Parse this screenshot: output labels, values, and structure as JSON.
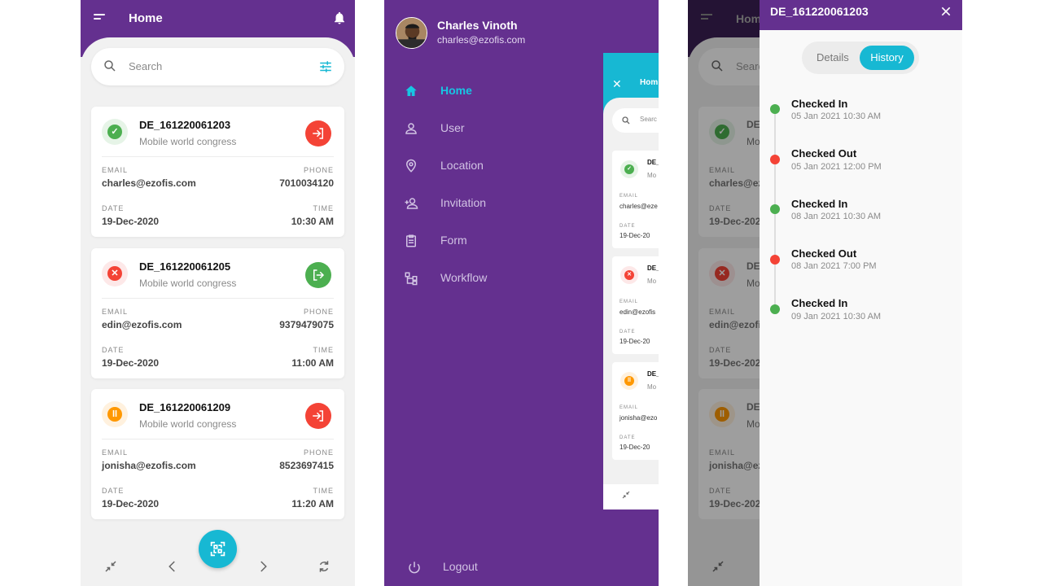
{
  "home": {
    "title": "Home",
    "search_placeholder": "Search",
    "cards": [
      {
        "id": "DE_161220061203",
        "event": "Mobile world congress",
        "email_label": "EMAIL",
        "email": "charles@ezofis.com",
        "phone_label": "PHONE",
        "phone": "7010034120",
        "date_label": "DATE",
        "date": "19-Dec-2020",
        "time_label": "TIME",
        "time": "10:30 AM",
        "status": "checked",
        "action": "check-in"
      },
      {
        "id": "DE_161220061205",
        "event": "Mobile world congress",
        "email_label": "EMAIL",
        "email": "edin@ezofis.com",
        "phone_label": "PHONE",
        "phone": "9379479075",
        "date_label": "DATE",
        "date": "19-Dec-2020",
        "time_label": "TIME",
        "time": "11:00 AM",
        "status": "rejected",
        "action": "check-out"
      },
      {
        "id": "DE_161220061209",
        "event": "Mobile world congress",
        "email_label": "EMAIL",
        "email": "jonisha@ezofis.com",
        "phone_label": "PHONE",
        "phone": "8523697415",
        "date_label": "DATE",
        "date": "19-Dec-2020",
        "time_label": "TIME",
        "time": "11:20 AM",
        "status": "paused",
        "action": "check-in"
      }
    ]
  },
  "drawer": {
    "user_name": "Charles Vinoth",
    "user_email": "charles@ezofis.com",
    "items": [
      {
        "label": "Home",
        "icon": "home-icon",
        "active": true
      },
      {
        "label": "User",
        "icon": "user-icon"
      },
      {
        "label": "Location",
        "icon": "location-pin-icon"
      },
      {
        "label": "Invitation",
        "icon": "add-user-icon"
      },
      {
        "label": "Form",
        "icon": "clipboard-icon"
      },
      {
        "label": "Workflow",
        "icon": "workflow-icon"
      }
    ],
    "logout": "Logout",
    "preview": {
      "title": "Hom",
      "search": "Searc",
      "cards": [
        {
          "id": "DE_",
          "sub": "Mo",
          "email_label": "EMAIL",
          "email": "charles@eze",
          "date_label": "DATE",
          "date": "19-Dec-20"
        },
        {
          "id": "DE_",
          "sub": "Mo",
          "email_label": "EMAIL",
          "email": "edin@ezofis",
          "date_label": "DATE",
          "date": "19-Dec-20"
        },
        {
          "id": "DE_",
          "sub": "Mo",
          "email_label": "EMAIL",
          "email": "jonisha@ezo",
          "date_label": "DATE",
          "date": "19-Dec-20"
        }
      ]
    }
  },
  "history": {
    "title": "DE_161220061203",
    "tab_details": "Details",
    "tab_history": "History",
    "events": [
      {
        "title": "Checked In",
        "time": "05 Jan 2021 10:30 AM",
        "color": "#4caf50"
      },
      {
        "title": "Checked Out",
        "time": "05 Jan 2021 12:00 PM",
        "color": "#f44336"
      },
      {
        "title": "Checked In",
        "time": "08 Jan 2021 10:30 AM",
        "color": "#4caf50"
      },
      {
        "title": "Checked Out",
        "time": "08 Jan 2021 7:00 PM",
        "color": "#f44336"
      },
      {
        "title": "Checked In",
        "time": "09 Jan 2021 10:30 AM",
        "color": "#4caf50"
      }
    ],
    "background": {
      "title": "Home",
      "search": "Searc",
      "cards": [
        {
          "id": "DE",
          "sub": "Mo",
          "email_label": "EMAIL",
          "email": "charles@ezo",
          "date_label": "DATE",
          "date": "19-Dec-202"
        },
        {
          "id": "DE",
          "sub": "Mo",
          "email_label": "EMAIL",
          "email": "edin@ezofis",
          "date_label": "DATE",
          "date": "19-Dec-202"
        },
        {
          "id": "DE",
          "sub": "Mo",
          "email_label": "EMAIL",
          "email": "jonisha@ezo",
          "date_label": "DATE",
          "date": "19-Dec-202"
        }
      ]
    }
  },
  "colors": {
    "primary": "#64308f",
    "accent": "#17b8d3",
    "green": "#4caf50",
    "red": "#f44336",
    "orange": "#ff9800"
  }
}
